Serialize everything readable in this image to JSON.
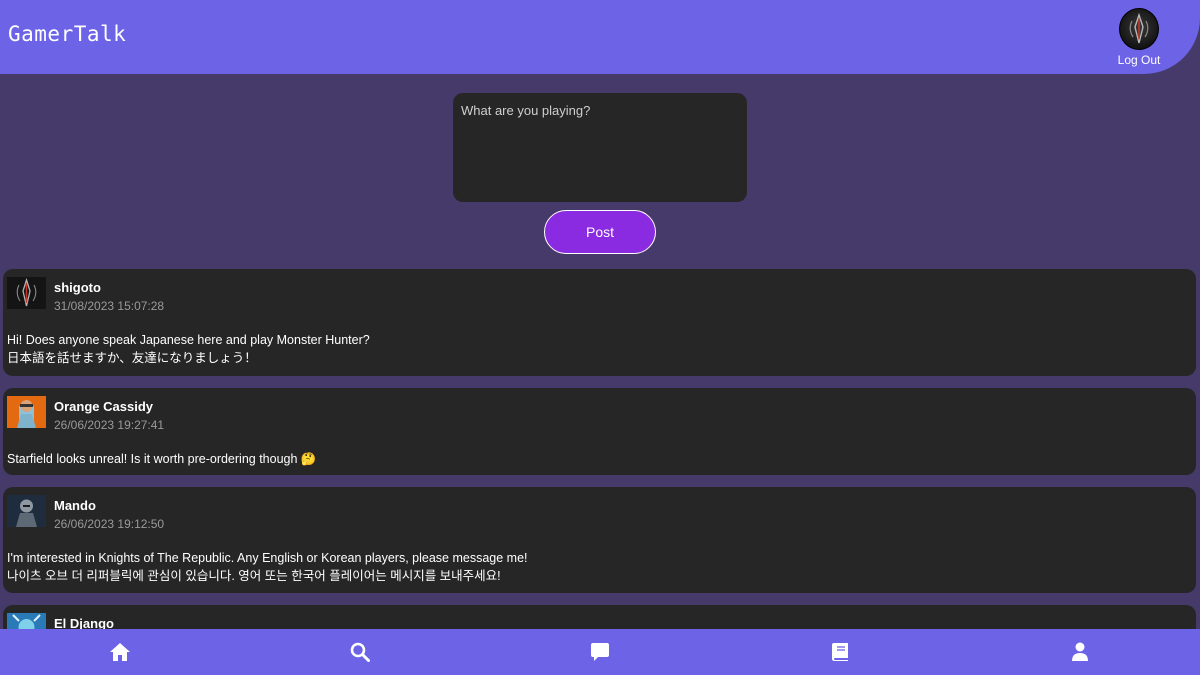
{
  "header": {
    "app_title": "GamerTalk",
    "logout_label": "Log Out"
  },
  "composer": {
    "placeholder": "What are you playing?",
    "post_label": "Post"
  },
  "posts": [
    {
      "username": "shigoto",
      "timestamp": "31/08/2023 15:07:28",
      "line1": "Hi! Does anyone speak Japanese here and play Monster Hunter?",
      "line2": "日本語を話せますか、友達になりましょう！"
    },
    {
      "username": "Orange Cassidy",
      "timestamp": "26/06/2023 19:27:41",
      "line1": "Starfield looks unreal! Is it worth pre-ordering though 🤔"
    },
    {
      "username": "Mando",
      "timestamp": "26/06/2023 19:12:50",
      "line1": "I'm interested in Knights of The Republic. Any English or Korean players, please message me!",
      "line2": "나이츠 오브 더 리퍼블릭에 관심이 있습니다. 영어 또는 한국어 플레이어는 메시지를 보내주세요!"
    },
    {
      "username": "El Django"
    }
  ],
  "nav": {
    "icons": [
      "home-icon",
      "search-icon",
      "chat-icon",
      "book-icon",
      "user-icon"
    ]
  },
  "colors": {
    "header": "#6c63e6",
    "background": "#453a6a",
    "card": "#262626",
    "accent": "#8a2be2"
  }
}
